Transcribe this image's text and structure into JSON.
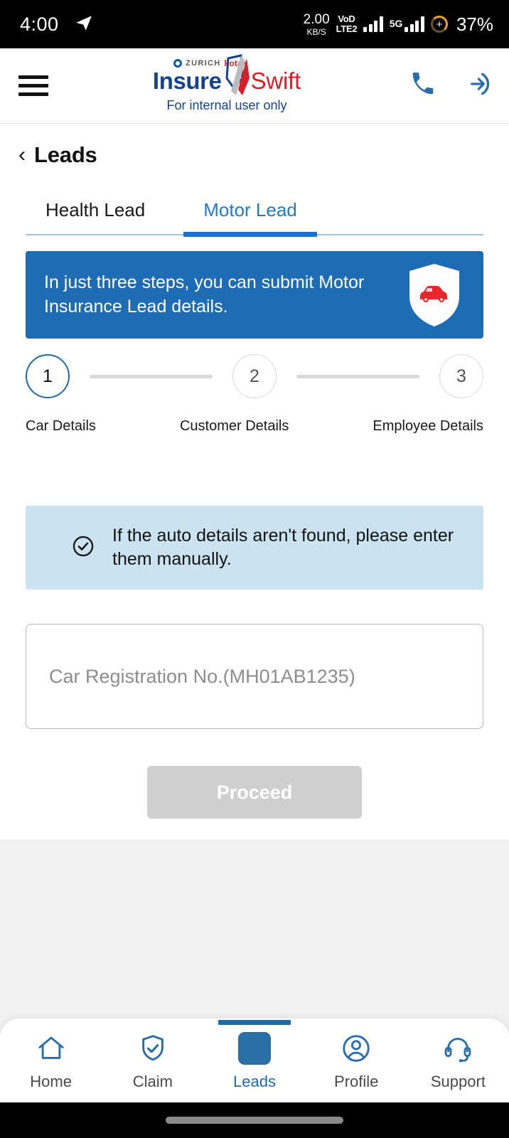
{
  "status_bar": {
    "time": "4:00",
    "nav_icon": "telegram-icon",
    "data_speed_value": "2.00",
    "data_speed_unit": "KB/S",
    "volte_line1": "VoD",
    "volte_line2": "LTE2",
    "network_type": "5G",
    "battery_percent": "37%"
  },
  "app_bar": {
    "menu_icon": "hamburger-menu-icon",
    "brand_zurich": "ZURICH",
    "brand_kotak": "kotak",
    "brand_primary": "Insure",
    "brand_secondary": "Swift",
    "brand_subtitle": "For internal user only",
    "call_icon": "phone-icon",
    "logout_icon": "logout-arrow-icon"
  },
  "page": {
    "back_icon": "chevron-left-icon",
    "title": "Leads"
  },
  "tabs": [
    {
      "label": "Health Lead",
      "active": false
    },
    {
      "label": "Motor Lead",
      "active": true
    }
  ],
  "promo": {
    "text": "In just three steps, you can submit Motor Insurance Lead details.",
    "icon": "shield-car-icon",
    "background": "#1d6cb4"
  },
  "stepper": {
    "steps": [
      {
        "number": "1",
        "label": "Car Details",
        "active": true
      },
      {
        "number": "2",
        "label": "Customer Details",
        "active": false
      },
      {
        "number": "3",
        "label": "Employee Details",
        "active": false
      }
    ],
    "active_color": "#1f6ba8",
    "inactive_color": "#d8d8d8"
  },
  "info_box": {
    "icon": "check-circle-icon",
    "text": "If the auto details aren't found, please enter them manually.",
    "background": "#cbe3f0"
  },
  "form": {
    "registration_placeholder": "Car Registration No.(MH01AB1235)",
    "registration_value": ""
  },
  "actions": {
    "proceed_label": "Proceed",
    "proceed_disabled": true,
    "proceed_color": "#cfcfcf"
  },
  "bottom_nav": {
    "active_color": "#1f6ba8",
    "items": [
      {
        "label": "Home",
        "icon": "home-icon",
        "active": false
      },
      {
        "label": "Claim",
        "icon": "shield-check-icon",
        "active": false
      },
      {
        "label": "Leads",
        "icon": "leads-square-icon",
        "active": true
      },
      {
        "label": "Profile",
        "icon": "user-circle-icon",
        "active": false
      },
      {
        "label": "Support",
        "icon": "headset-icon",
        "active": false
      }
    ]
  }
}
